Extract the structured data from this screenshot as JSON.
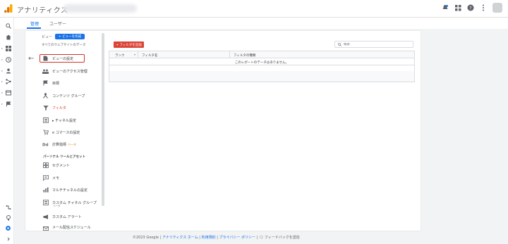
{
  "app": {
    "title": "アナリティクス"
  },
  "tabs": [
    {
      "label": "管理"
    },
    {
      "label": "ユーザー"
    }
  ],
  "view_panel": {
    "label": "ビュー",
    "create_button": "+ ビューを作成",
    "view_name": "すべてのウェブサイトのデータ"
  },
  "menu": {
    "items": [
      {
        "label": "ビューの設定",
        "icon": "document-icon"
      },
      {
        "label": "ビューのアクセス管理",
        "icon": "people-icon"
      },
      {
        "label": "目標",
        "icon": "flag-icon"
      },
      {
        "label": "コンテンツ グループ",
        "icon": "person-icon"
      },
      {
        "label": "フィルタ",
        "icon": "filter-icon"
      },
      {
        "label": "チャネル設定",
        "icon": "channel-icon"
      },
      {
        "label": "e コマースの設定",
        "icon": "cart-icon"
      },
      {
        "label": "計算指標",
        "icon": "dd-icon",
        "badge": "ベータ"
      }
    ],
    "section_header": "パーソナル ツールとアセット",
    "personal_items": [
      {
        "label": "セグメント",
        "icon": "segment-icon"
      },
      {
        "label": "メモ",
        "icon": "memo-icon"
      },
      {
        "label": "マルチチャネルの設定",
        "icon": "bar-chart-icon"
      },
      {
        "label": "カスタム チャネル グループ",
        "icon": "channel-icon",
        "sub": "ベータ"
      },
      {
        "label": "カスタム アラート",
        "icon": "megaphone-icon"
      },
      {
        "label": "メール配信スケジュール",
        "icon": "mail-icon"
      }
    ]
  },
  "filters": {
    "add_button": "+ フィルタを追加",
    "search_placeholder": "検索",
    "columns": [
      "ランク",
      "フィルタ名",
      "フィルタの種類"
    ],
    "empty_message": "このレポートのデータはありません。"
  },
  "footer": {
    "copyright": "©2023 Google",
    "links": [
      "アナリティクス ホーム",
      "利用規約",
      "プライバシー ポリシー"
    ],
    "feedback": "フィードバックを送信"
  },
  "colors": {
    "accent": "#1a73e8",
    "danger": "#db4437",
    "logo": "#f9ab00"
  }
}
